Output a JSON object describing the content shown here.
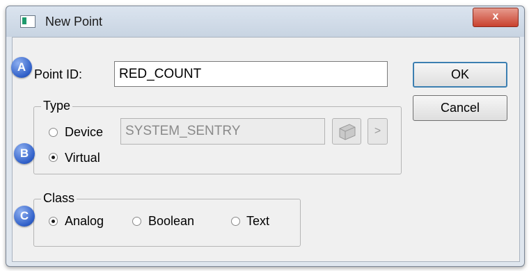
{
  "window": {
    "title": "New Point",
    "close_label": "x"
  },
  "point_id": {
    "label": "Point ID:",
    "value": "RED_COUNT"
  },
  "buttons": {
    "ok": "OK",
    "cancel": "Cancel"
  },
  "type_group": {
    "legend": "Type",
    "device_label": "Device",
    "device_value": "SYSTEM_SENTRY",
    "virtual_label": "Virtual",
    "selected": "Virtual",
    "next_glyph": ">"
  },
  "class_group": {
    "legend": "Class",
    "options": [
      "Analog",
      "Boolean",
      "Text"
    ],
    "selected": "Analog"
  },
  "callouts": [
    "A",
    "B",
    "C"
  ]
}
